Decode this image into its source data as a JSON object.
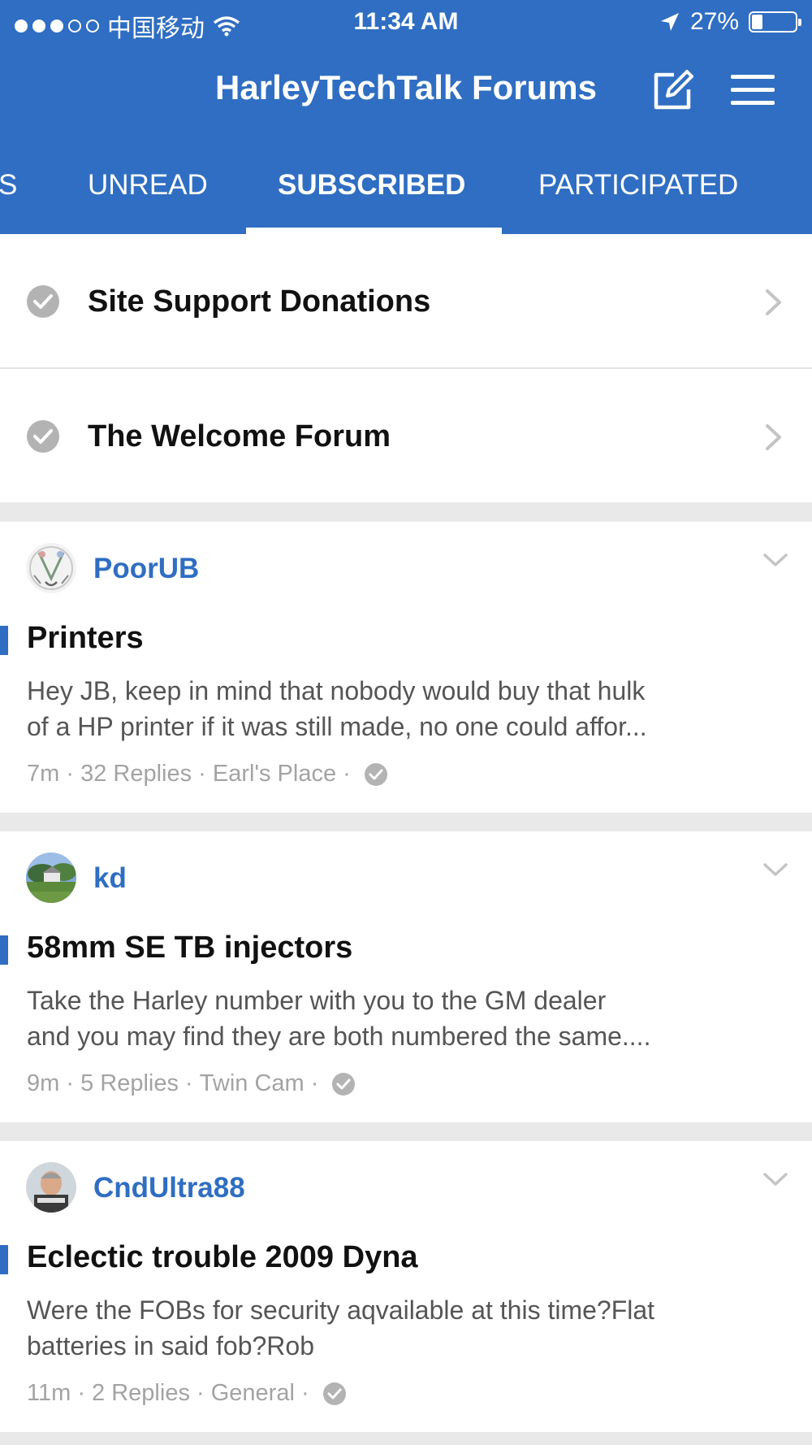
{
  "status_bar": {
    "carrier": "中国移动",
    "time": "11:34 AM",
    "battery": "27%"
  },
  "header": {
    "title": "HarleyTechTalk Forums",
    "compose_icon": "compose-icon",
    "menu_icon": "hamburger-menu-icon"
  },
  "tabs": [
    {
      "label": "S"
    },
    {
      "label": "UNREAD"
    },
    {
      "label": "SUBSCRIBED",
      "active": true
    },
    {
      "label": "PARTICIPATED"
    }
  ],
  "forums": [
    {
      "name": "Site Support Donations"
    },
    {
      "name": "The Welcome Forum"
    }
  ],
  "threads": [
    {
      "author": "PoorUB",
      "title": "Printers",
      "excerpt_line1": "Hey JB, keep in mind that nobody would buy that hulk",
      "excerpt_line2": "of a HP printer if it was still made, no one could affor...",
      "time": "7m",
      "replies": "32 Replies",
      "forum": "Earl's Place"
    },
    {
      "author": "kd",
      "title": "58mm SE TB injectors",
      "excerpt_line1": "Take the Harley number with you to the GM dealer",
      "excerpt_line2": "and you may find they are both numbered the same....",
      "time": "9m",
      "replies": "5 Replies",
      "forum": "Twin Cam"
    },
    {
      "author": "CndUltra88",
      "title": "Eclectic trouble 2009 Dyna",
      "excerpt_line1": "Were the FOBs for security aqvailable at this time?Flat",
      "excerpt_line2": "batteries in said fob?Rob",
      "time": "11m",
      "replies": "2 Replies",
      "forum": "General"
    }
  ],
  "colors": {
    "brand": "#2f6ec2",
    "meta": "#a3a3a3",
    "check": "#b3b3b3"
  }
}
